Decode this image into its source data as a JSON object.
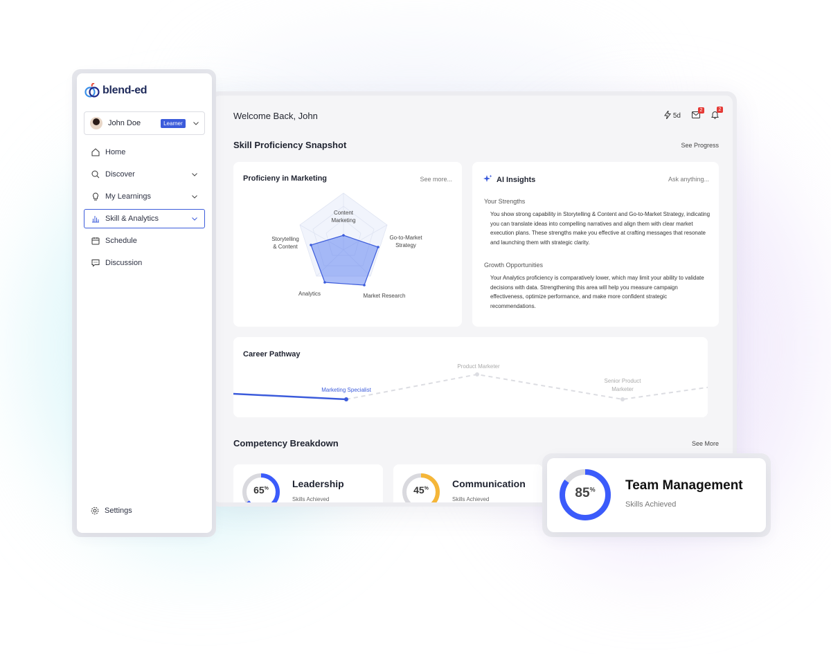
{
  "brand": {
    "name": "blend-ed",
    "accent": "#3b5bdb"
  },
  "user": {
    "name": "John Doe",
    "role": "Learner"
  },
  "sidebar": {
    "items": [
      {
        "label": "Home",
        "icon": "home-icon"
      },
      {
        "label": "Discover",
        "icon": "search-icon"
      },
      {
        "label": "My Learnings",
        "icon": "lightbulb-icon"
      },
      {
        "label": "Skill & Analytics",
        "icon": "bar-chart-icon"
      },
      {
        "label": "Schedule",
        "icon": "calendar-icon"
      },
      {
        "label": "Discussion",
        "icon": "chat-icon"
      }
    ],
    "settings_label": "Settings"
  },
  "header": {
    "welcome": "Welcome Back, John",
    "streak": "5d",
    "messages_count": "2",
    "notifications_count": "2"
  },
  "snapshot": {
    "title": "Skill Proficiency Snapshot",
    "see_progress": "See Progress"
  },
  "proficiency": {
    "title": "Proficieny in Marketing",
    "see_more": "See more...",
    "labels": {
      "content_1": "Content",
      "content_2": "Marketing",
      "gtm_1": "Go-to-Market",
      "gtm_2": "Strategy",
      "story_1": "Storytelling",
      "story_2": "& Content",
      "analytics": "Analytics",
      "research": "Market Research"
    }
  },
  "ai": {
    "title": "AI Insights",
    "ask": "Ask anything...",
    "strengths_title": "Your Strengths",
    "strengths_text": "You show strong capability in Storytelling & Content and Go-to-Market Strategy, indicating you can translate ideas into compelling narratives and align them with clear market execution plans. These strengths make you effective at crafting messages that resonate and launching them with strategic clarity.",
    "growth_title": "Growth Opportunities",
    "growth_text": "Your Analytics proficiency is comparatively lower, which may limit your ability to validate decisions with data. Strengthening this area will help you measure campaign effectiveness, optimize performance, and make more confident strategic recommendations."
  },
  "career": {
    "title": "Career Pathway",
    "current": "Marketing Specialist",
    "next": "Product Marketer",
    "future_1": "Senior Product",
    "future_2": "Marketer"
  },
  "competency": {
    "title": "Competency Breakdown",
    "see_more": "See More",
    "items": [
      {
        "name": "Leadership",
        "pct": "65",
        "sub": "Skills Achieved",
        "color": "#3b5bfb"
      },
      {
        "name": "Communication",
        "pct": "45",
        "sub": "Skills Achieved",
        "color": "#f5b638"
      },
      {
        "name": "Team Management",
        "pct": "85",
        "sub": "Skills Achieved",
        "color": "#3b5bfb"
      }
    ],
    "pct_sign": "%"
  }
}
